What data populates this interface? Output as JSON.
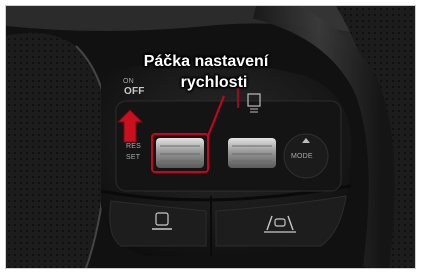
{
  "image": {
    "callout": {
      "line1": "Páčka nastavení",
      "line2": "rychlosti",
      "highlight_color": "#d00020",
      "arrow_color": "#c8101e"
    },
    "switch_labels": {
      "on": "ON",
      "off": "OFF",
      "res": "RES",
      "set": "SET",
      "mode": "MODE"
    },
    "icons": [
      "up-arrow-icon",
      "following-distance-icon",
      "driving-mode-icon",
      "lane-assist-icon"
    ]
  }
}
